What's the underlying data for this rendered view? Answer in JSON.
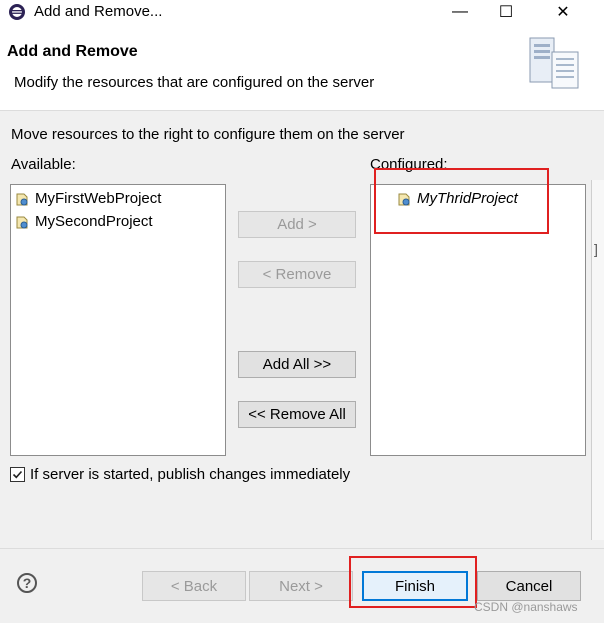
{
  "window": {
    "title": "Add and Remove...",
    "minimize_glyph": "—",
    "maximize_glyph": "☐",
    "close_glyph": "✕"
  },
  "header": {
    "heading": "Add and Remove",
    "subtitle": "Modify the resources that are configured on the server"
  },
  "body": {
    "instruction": "Move resources to the right to configure them on the server",
    "available_label": "Available:",
    "configured_label": "Configured:",
    "available_items": [
      "MyFirstWebProject",
      "MySecondProject"
    ],
    "configured_items": [
      "MyThridProject"
    ]
  },
  "buttons": {
    "add": "Add >",
    "remove": "< Remove",
    "add_all": "Add All >>",
    "remove_all": "<< Remove All"
  },
  "publish_option": {
    "label": "If server is started, publish changes immediately",
    "checked": true
  },
  "footer": {
    "help_glyph": "?",
    "back": "< Back",
    "next": "Next >",
    "finish": "Finish",
    "cancel": "Cancel"
  },
  "watermark": "CSDN @nanshaws",
  "edge_glyph": "]",
  "colors": {
    "annotation": "#e02020",
    "focus": "#0078d7"
  }
}
